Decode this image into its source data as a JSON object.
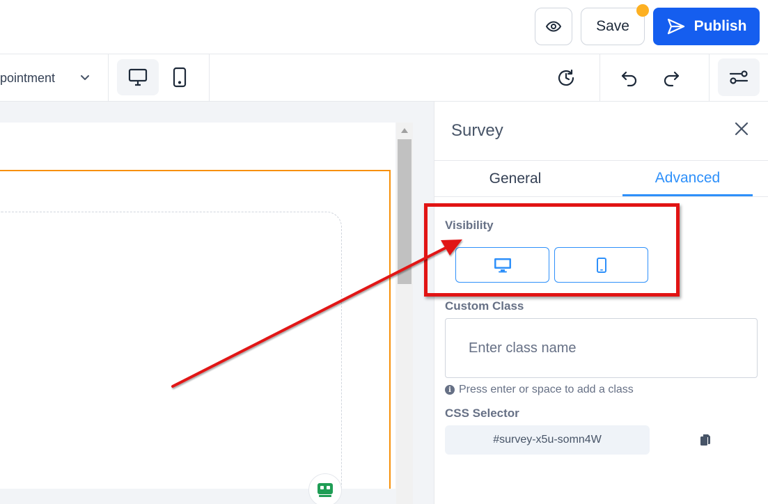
{
  "topbar": {
    "preview_icon": "eye-icon",
    "save_label": "Save",
    "unsaved_indicator_color": "#fdb022",
    "publish_label": "Publish",
    "publish_icon": "send-icon",
    "publish_color": "#155eef"
  },
  "toolbar": {
    "page_name": "ppointment",
    "page_chevron_icon": "chevron-down-icon",
    "devices": [
      {
        "name": "desktop",
        "icon": "desktop-icon",
        "active": true
      },
      {
        "name": "mobile",
        "icon": "mobile-icon",
        "active": false
      }
    ],
    "history_icon": "history-icon",
    "undo_icon": "undo-icon",
    "redo_icon": "redo-icon",
    "settings_icon": "settings-sliders-icon"
  },
  "canvas": {
    "selection_color": "#f79009",
    "badge_icon": "bot-icon"
  },
  "panel": {
    "title": "Survey",
    "close_icon": "close-icon",
    "tabs": [
      {
        "label": "General",
        "active": false
      },
      {
        "label": "Advanced",
        "active": true
      }
    ],
    "accent_color": "#2e90fa",
    "visibility": {
      "label": "Visibility",
      "options": [
        {
          "name": "desktop",
          "icon": "desktop-icon"
        },
        {
          "name": "mobile",
          "icon": "mobile-icon"
        }
      ]
    },
    "custom_class": {
      "label": "Custom Class",
      "placeholder": "Enter class name",
      "hint": "Press enter or space to add a class"
    },
    "css_selector": {
      "label": "CSS Selector",
      "value": "#survey-x5u-somn4W",
      "copy_icon": "copy-icon"
    }
  },
  "annotation": {
    "color": "#e11414"
  }
}
